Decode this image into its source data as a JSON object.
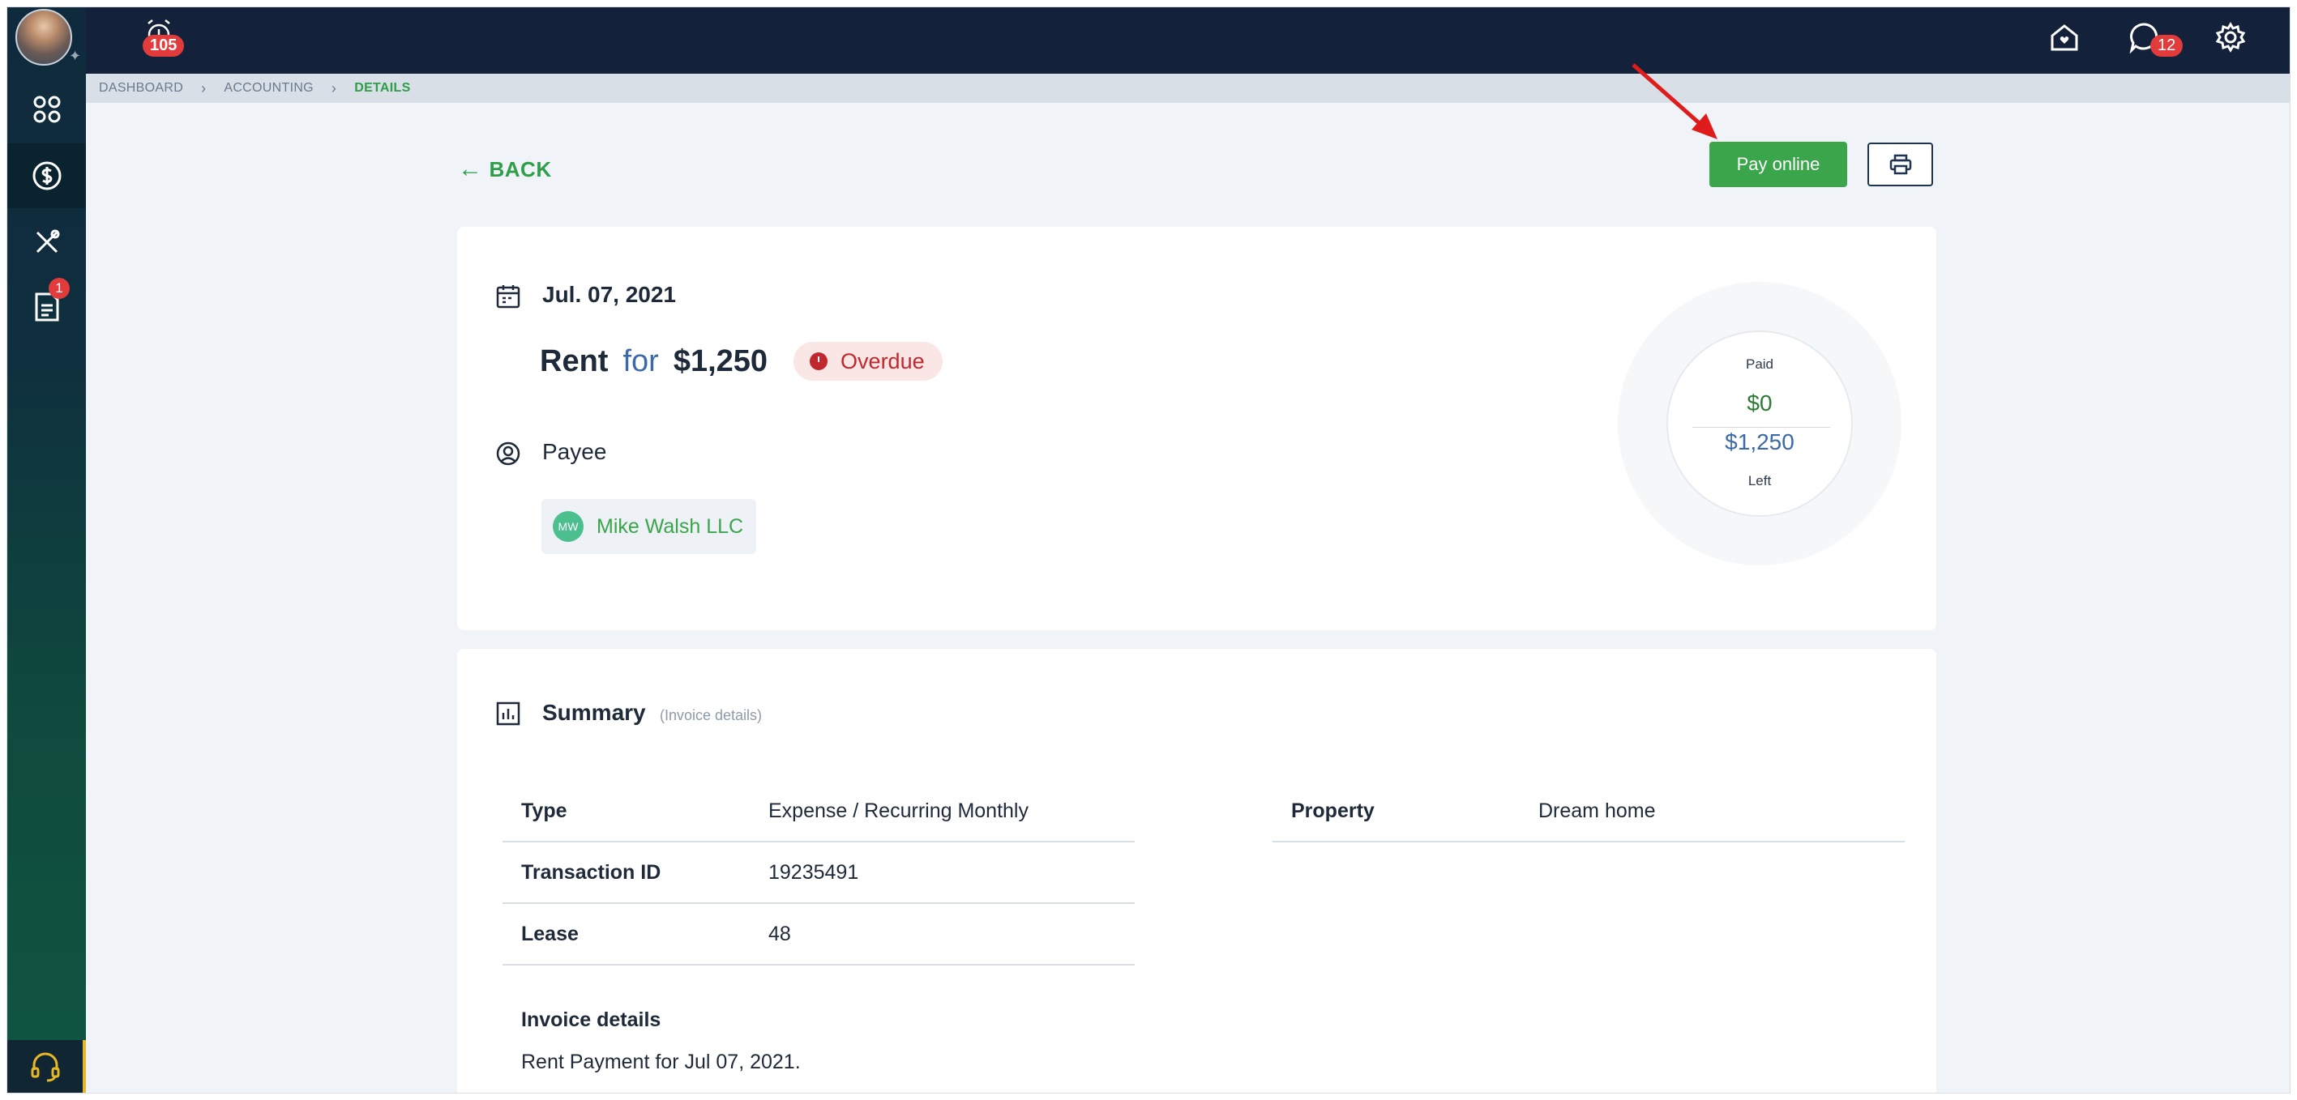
{
  "topbar": {
    "alarm_count": "105",
    "messages_count": "12"
  },
  "sidebar": {
    "items": [
      {
        "icon": "dashboard-grid-icon"
      },
      {
        "icon": "accounting-dollar-icon"
      },
      {
        "icon": "tools-icon"
      },
      {
        "icon": "document-icon",
        "badge": "1"
      }
    ]
  },
  "breadcrumb": [
    "DASHBOARD",
    "ACCOUNTING",
    "DETAILS"
  ],
  "actions": {
    "back_label": "BACK",
    "pay_label": "Pay online"
  },
  "invoice": {
    "date": "Jul. 07, 2021",
    "category": "Rent",
    "for_word": "for",
    "amount": "$1,250",
    "status": "Overdue",
    "payee_label": "Payee",
    "payee_initials": "MW",
    "payee_name": "Mike Walsh LLC",
    "paid_label": "Paid",
    "paid_value": "$0",
    "left_value": "$1,250",
    "left_label": "Left"
  },
  "summary": {
    "title": "Summary",
    "subtitle": "(Invoice details)",
    "left_rows": [
      {
        "key": "Type",
        "value": "Expense / Recurring Monthly"
      },
      {
        "key": "Transaction ID",
        "value": "19235491"
      },
      {
        "key": "Lease",
        "value": "48"
      }
    ],
    "right_rows": [
      {
        "key": "Property",
        "value": "Dream home"
      }
    ],
    "details_label": "Invoice details",
    "details_text": "Rent Payment for Jul 07, 2021."
  },
  "colors": {
    "accent_green": "#3aa54a",
    "navy": "#13223a",
    "overdue_red": "#c0282d"
  }
}
